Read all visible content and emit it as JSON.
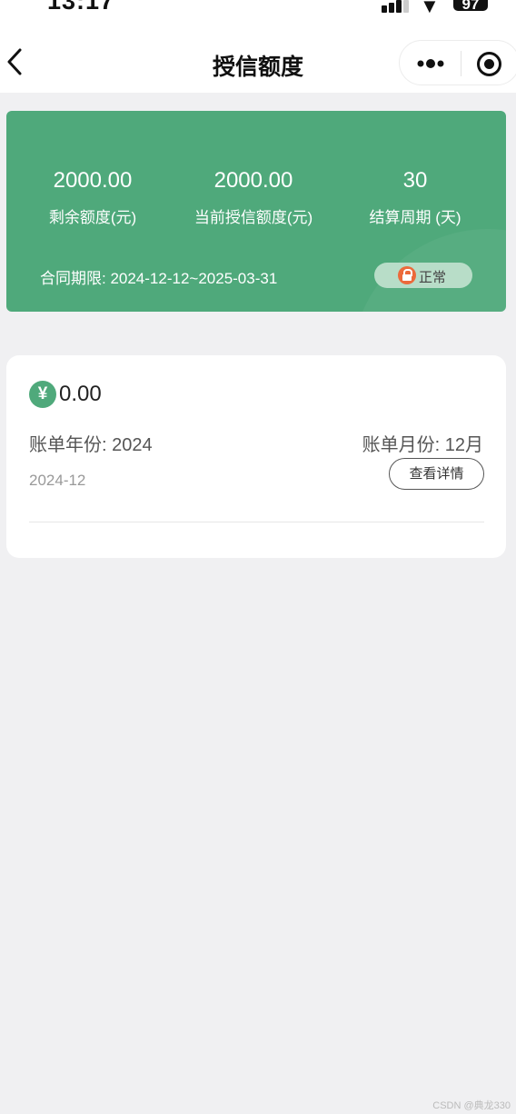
{
  "status_bar": {
    "time": "13:17",
    "battery": "97",
    "icons": [
      "signal-icon",
      "wifi-icon",
      "battery-icon"
    ]
  },
  "nav": {
    "title": "授信额度",
    "back_icon": "chevron-left-icon",
    "more_icon": "more-dots-icon",
    "close_icon": "target-close-icon"
  },
  "credit": {
    "stats": [
      {
        "value": "2000.00",
        "label": "剩余额度(元)"
      },
      {
        "value": "2000.00",
        "label": "当前授信额度(元)"
      },
      {
        "value": "30",
        "label": "结算周期 (天)"
      }
    ],
    "contract": "合同期限: 2024-12-12~2025-03-31",
    "status": "正常",
    "status_icon": "lock-icon"
  },
  "bill": {
    "currency_icon": "yen-icon",
    "currency_symbol": "¥",
    "amount": "0.00",
    "year": "账单年份: 2024",
    "month": "账单月份: 12月",
    "period": "2024-12",
    "detail_label": "查看详情"
  },
  "watermark": "CSDN @典龙330",
  "colors": {
    "accent_green": "#4fa97b",
    "badge_bg": "#b8ddc8",
    "lock_orange": "#ec6a3b",
    "page_bg": "#f0f0f2"
  }
}
